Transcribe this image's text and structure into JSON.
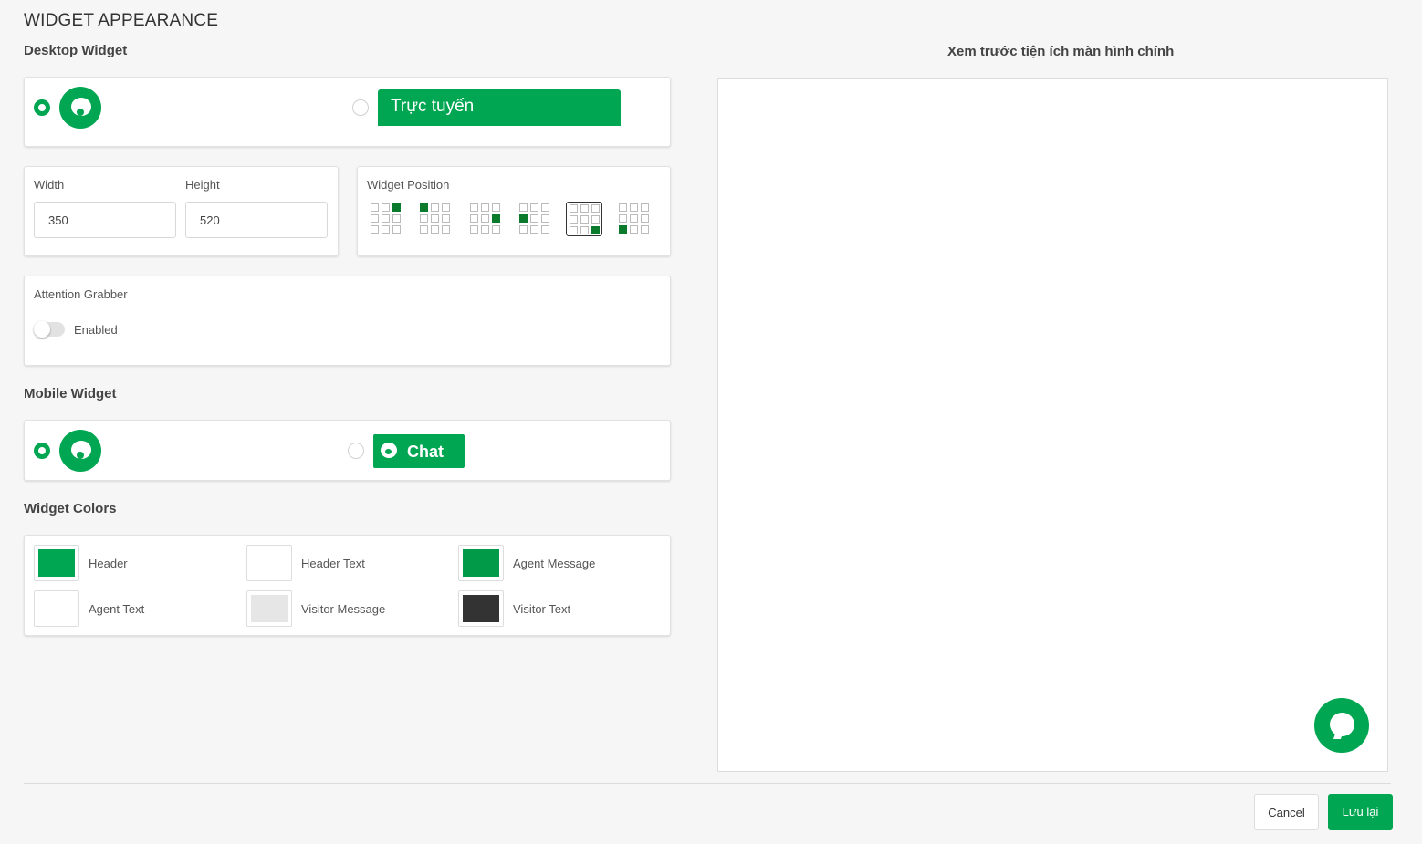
{
  "page": {
    "title": "WIDGET APPEARANCE"
  },
  "desktop": {
    "section_title": "Desktop Widget",
    "online_label": "Trực tuyến"
  },
  "size": {
    "width_label": "Width",
    "width_value": "350",
    "height_label": "Height",
    "height_value": "520"
  },
  "position": {
    "label": "Widget Position",
    "selected_index": 4
  },
  "attention": {
    "title": "Attention Grabber",
    "toggle_label": "Enabled",
    "enabled": false
  },
  "mobile": {
    "section_title": "Mobile Widget",
    "chat_label": "Chat"
  },
  "colors": {
    "section_title": "Widget Colors",
    "items": [
      {
        "label": "Header",
        "color": "#00a651"
      },
      {
        "label": "Header Text",
        "color": "#ffffff"
      },
      {
        "label": "Agent Message",
        "color": "#009a49"
      },
      {
        "label": "Agent Text",
        "color": "#ffffff"
      },
      {
        "label": "Visitor Message",
        "color": "#e6e6e6"
      },
      {
        "label": "Visitor Text",
        "color": "#333333"
      }
    ]
  },
  "preview": {
    "title": "Xem trước tiện ích màn hình chính"
  },
  "footer": {
    "cancel_label": "Cancel",
    "save_label": "Lưu lại"
  },
  "theme": {
    "accent": "#00a651"
  }
}
